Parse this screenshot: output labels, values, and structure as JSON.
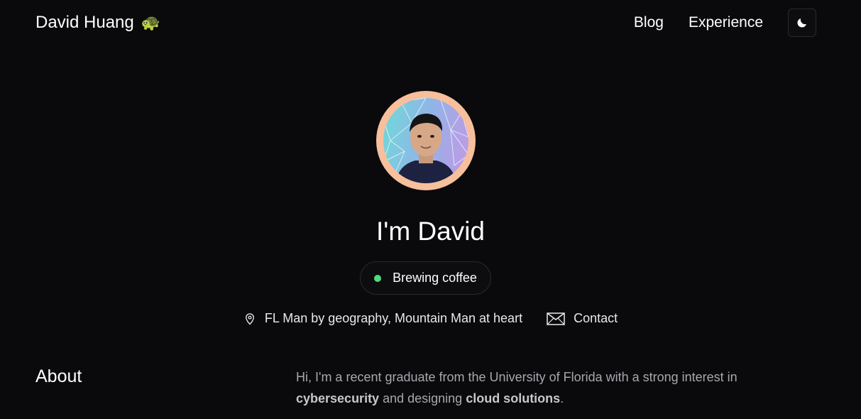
{
  "header": {
    "brand_name": "David Huang",
    "brand_emoji": "🐢",
    "nav": [
      {
        "label": "Blog"
      },
      {
        "label": "Experience"
      }
    ],
    "theme_toggle_icon": "moon-icon"
  },
  "hero": {
    "title": "I'm David",
    "status": {
      "text": "Brewing coffee",
      "dot_color": "#4ade80"
    },
    "location": {
      "icon": "map-pin-icon",
      "text": "FL Man by geography, Mountain Man at heart"
    },
    "contact": {
      "icon": "mail-icon",
      "label": "Contact"
    },
    "avatar_ring_color": "#f7bf9c"
  },
  "about": {
    "heading": "About",
    "text_part1": "Hi, I'm a recent graduate from the University of Florida with a strong interest in ",
    "highlight1": "cybersecurity",
    "text_part2": " and designing ",
    "highlight2": "cloud solutions",
    "text_part3": "."
  }
}
